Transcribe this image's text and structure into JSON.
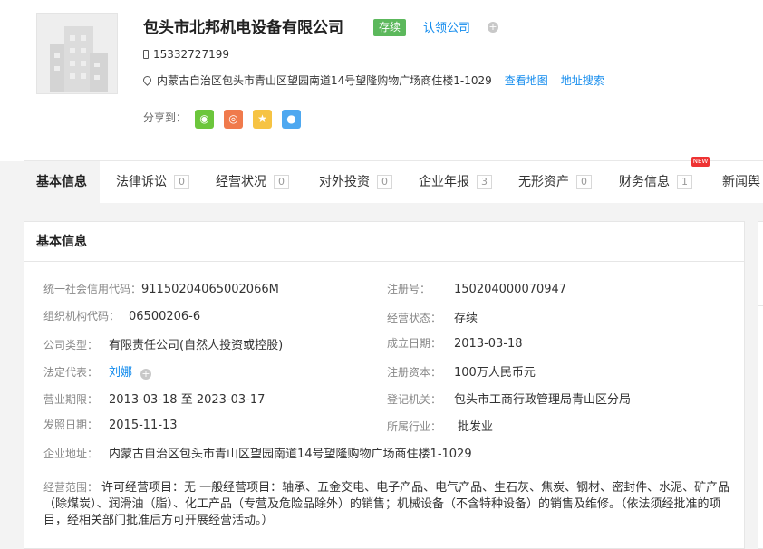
{
  "company": {
    "name": "包头市北邦机电设备有限公司",
    "status": "存续",
    "claim_label": "认领公司",
    "phone": "15332727199",
    "address": "内蒙古自治区包头市青山区望园南道14号望隆购物广场商住楼1-1029",
    "view_map": "查看地图",
    "address_search": "地址搜索",
    "share_label": "分享到："
  },
  "tabs": [
    {
      "label": "基本信息",
      "count": ""
    },
    {
      "label": "法律诉讼",
      "count": "0"
    },
    {
      "label": "经营状况",
      "count": "0"
    },
    {
      "label": "对外投资",
      "count": "0"
    },
    {
      "label": "企业年报",
      "count": "3"
    },
    {
      "label": "无形资产",
      "count": "0"
    },
    {
      "label": "财务信息",
      "count": "1"
    },
    {
      "label": "新闻舆",
      "count": ""
    }
  ],
  "new_badge": "NEW",
  "basic": {
    "title": "基本信息",
    "credit_code_label": "统一社会信用代码：",
    "credit_code": "91150204065002066M",
    "reg_no_label": "注册号：",
    "reg_no": "150204000070947",
    "org_code_label": "组织机构代码：",
    "org_code": "06500206-6",
    "op_status_label": "经营状态：",
    "op_status": "存续",
    "type_label": "公司类型：",
    "type": "有限责任公司(自然人投资或控股)",
    "found_label": "成立日期：",
    "found": "2013-03-18",
    "legal_label": "法定代表：",
    "legal": "刘娜",
    "capital_label": "注册资本：",
    "capital": "100万人民币元",
    "term_label": "营业期限：",
    "term": "2013-03-18 至 2023-03-17",
    "authority_label": "登记机关：",
    "authority": "包头市工商行政管理局青山区分局",
    "issue_label": "发照日期：",
    "issue": "2015-11-13",
    "industry_label": "所属行业：",
    "industry": "批发业",
    "address_label": "企业地址：",
    "address": "内蒙古自治区包头市青山区望园南道14号望隆购物广场商住楼1-1029",
    "scope_label": "经营范围：",
    "scope": "许可经营项目：无 一般经营项目：轴承、五金交电、电子产品、电气产品、生石灰、焦炭、钢材、密封件、水泥、矿产品（除煤炭）、润滑油（脂）、化工产品（专营及危险品除外）的销售；机械设备（不含特种设备）的销售及维修。（依法须经批准的项目，经相关部门批准后方可开展经营活动。）"
  },
  "colors": {
    "link": "#128bed",
    "status_green": "#5cb85c",
    "wechat": "#6cc63c",
    "weibo": "#f07a4c",
    "qzone": "#f6c343",
    "qq": "#4ea8f0"
  }
}
